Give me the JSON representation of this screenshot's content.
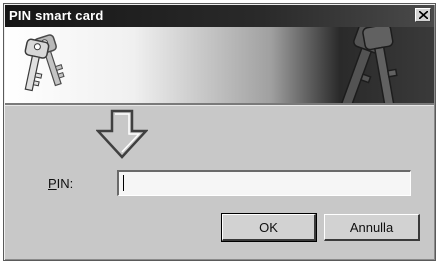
{
  "window": {
    "title": "PIN smart card",
    "close_label": "X"
  },
  "form": {
    "pin_label_accel": "P",
    "pin_label_rest": "IN:",
    "pin_value": ""
  },
  "buttons": {
    "ok_label": "OK",
    "cancel_label": "Annulla"
  },
  "icons": {
    "banner_left": "keys-icon",
    "banner_right": "keys-watermark-icon",
    "hint": "arrow-down-icon"
  }
}
